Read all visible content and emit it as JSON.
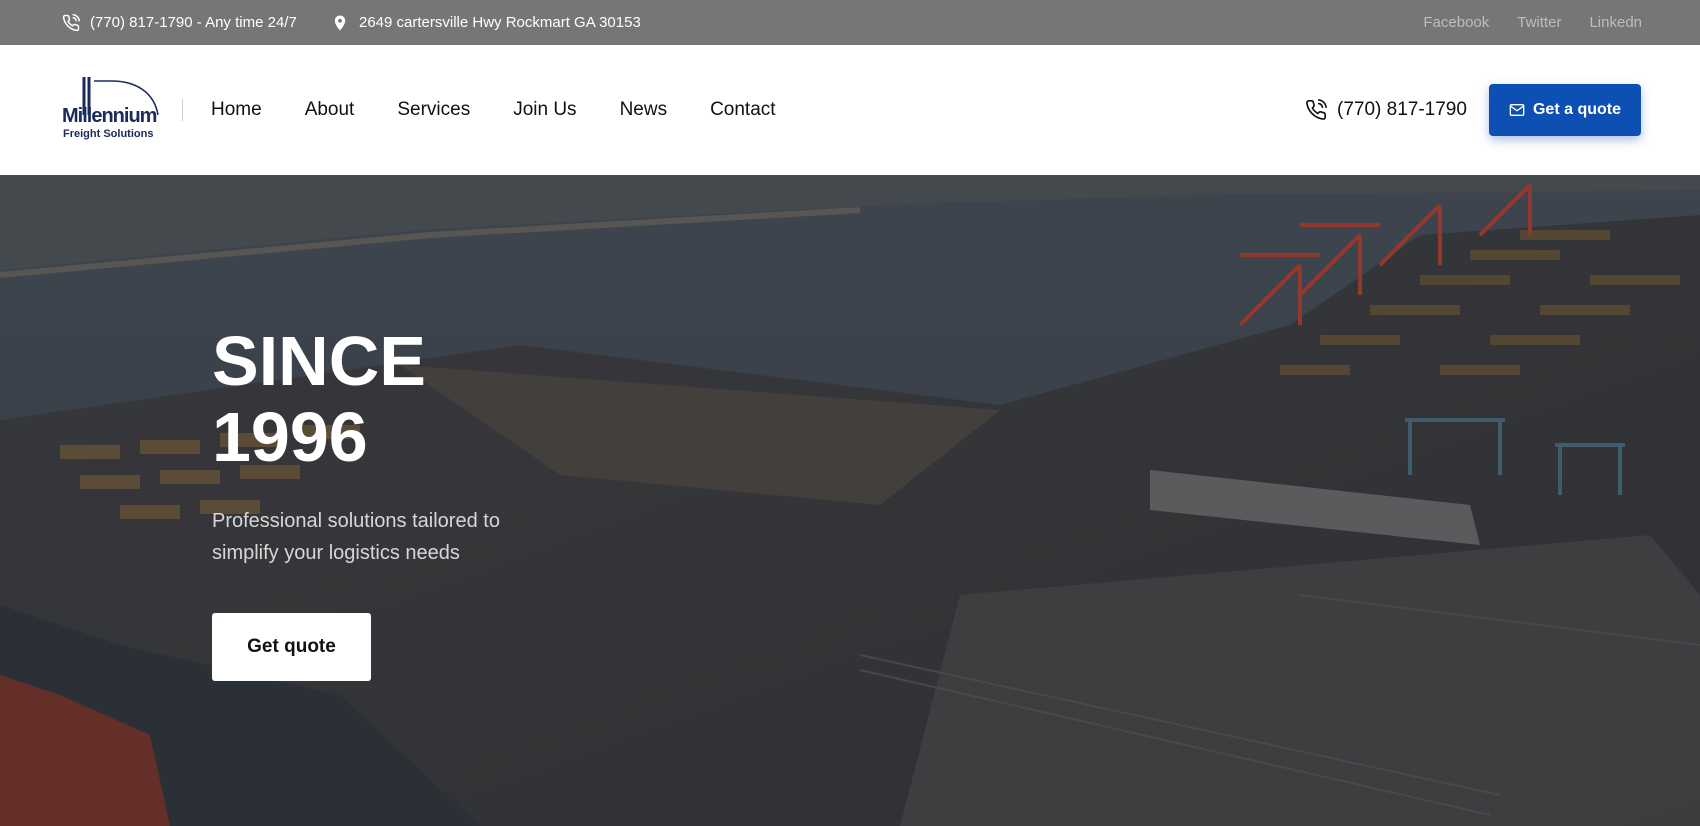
{
  "topbar": {
    "phone": "(770) 817-1790 - Any time 24/7",
    "address": "2649 cartersville Hwy Rockmart GA 30153",
    "social": [
      "Facebook",
      "Twitter",
      "Linkedn"
    ]
  },
  "header": {
    "logo_name": "Millennium",
    "logo_sub": "Freight Solutions",
    "nav": [
      "Home",
      "About",
      "Services",
      "Join Us",
      "News",
      "Contact"
    ],
    "phone": "(770) 817-1790",
    "quote_button": "Get a quote"
  },
  "hero": {
    "title_line1": "SINCE",
    "title_line2": "1996",
    "subtitle": "Professional solutions tailored to simplify your logistics needs",
    "button": "Get quote"
  },
  "colors": {
    "topbar": "#767676",
    "accent": "#0e4fb3",
    "logo": "#1b2a5c"
  },
  "icons": [
    "phone-icon",
    "location-pin-icon",
    "mail-icon"
  ]
}
